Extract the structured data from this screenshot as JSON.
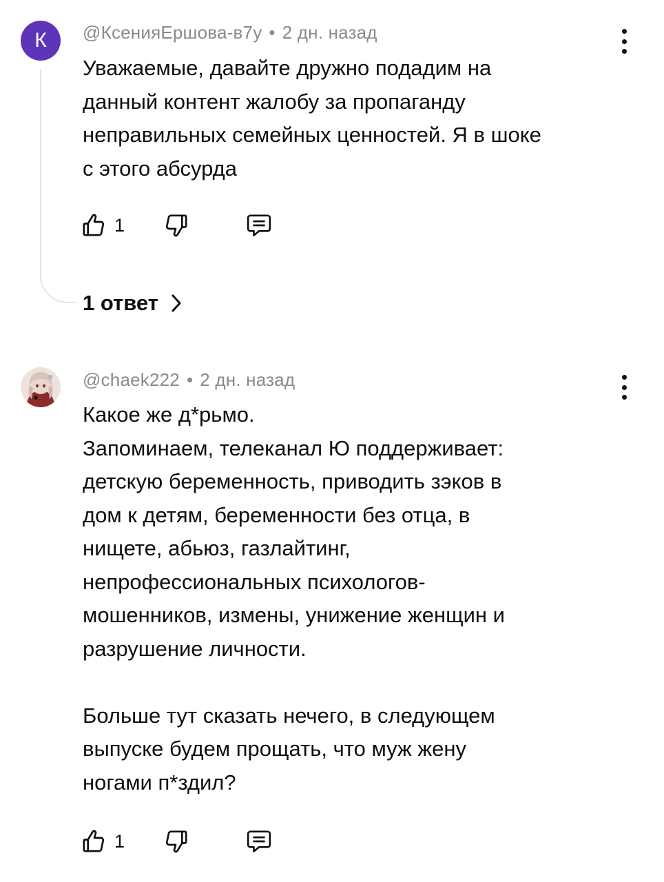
{
  "comments": [
    {
      "avatar_letter": "К",
      "avatar_color": "#5c35b8",
      "author": "@КсенияЕршова-в7у",
      "separator": "•",
      "time": "2 дн. назад",
      "text": "Уважаемые, давайте дружно подадим на\nданный контент жалобу за пропаганду\nнеправильных семейных ценностей. Я в шоке\nс этого абсурда",
      "likes": "1",
      "replies_label": "1 ответ"
    },
    {
      "author": "@chaek222",
      "separator": "•",
      "time": "2 дн. назад",
      "text": "Какое же д*рьмо.\nЗапоминаем, телеканал Ю поддерживает:\nдетскую беременность, приводить зэков в\nдом к детям, беременности без отца, в\nнищете, абьюз, газлайтинг,\nнепрофессиональных психологов-\nмошенников, измены, унижение женщин и\nразрушение личности.\n\nБольше тут сказать нечего, в следующем\nвыпуске будем прощать, что муж жену\nногами п*здил?",
      "likes": "1"
    }
  ],
  "icons": {
    "like": "thumb-up-icon",
    "dislike": "thumb-down-icon",
    "reply": "reply-comment-icon",
    "menu": "more-vertical-icon",
    "chevron": "chevron-right-icon"
  }
}
